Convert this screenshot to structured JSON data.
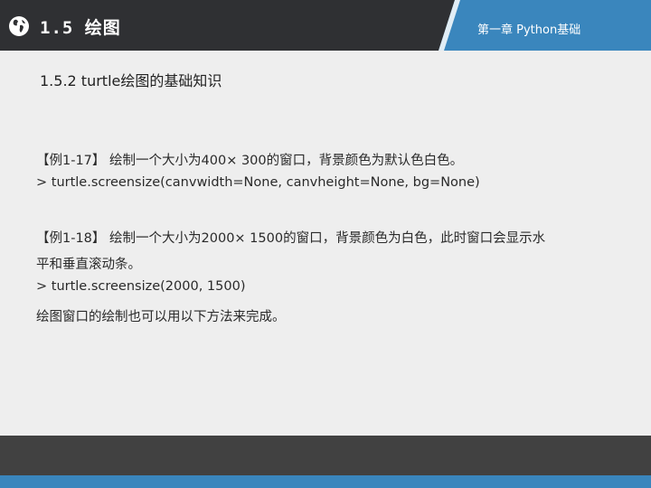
{
  "header": {
    "section_title": "1.5 绘图",
    "chapter_title": "第一章 Python基础"
  },
  "main": {
    "subheading": "1.5.2 turtle绘图的基础知识",
    "example1": {
      "text": "【例1-17】 绘制一个大小为400× 300的窗口，背景颜色为默认色白色。",
      "code": "> turtle.screensize(canvwidth=None, canvheight=None, bg=None)"
    },
    "example2": {
      "text_line1": "【例1-18】 绘制一个大小为2000× 1500的窗口，背景颜色为白色，此时窗口会显示水",
      "text_line2": "平和垂直滚动条。",
      "code": "> turtle.screensize(2000, 1500)"
    },
    "note": "绘图窗口的绘制也可以用以下方法来完成。"
  },
  "colors": {
    "header_blue": "#3a86bd",
    "header_dark": "#2f3033",
    "footer_dark": "#414141",
    "background": "#eeeeee"
  },
  "icons": {
    "header_icon": "globe-icon"
  }
}
